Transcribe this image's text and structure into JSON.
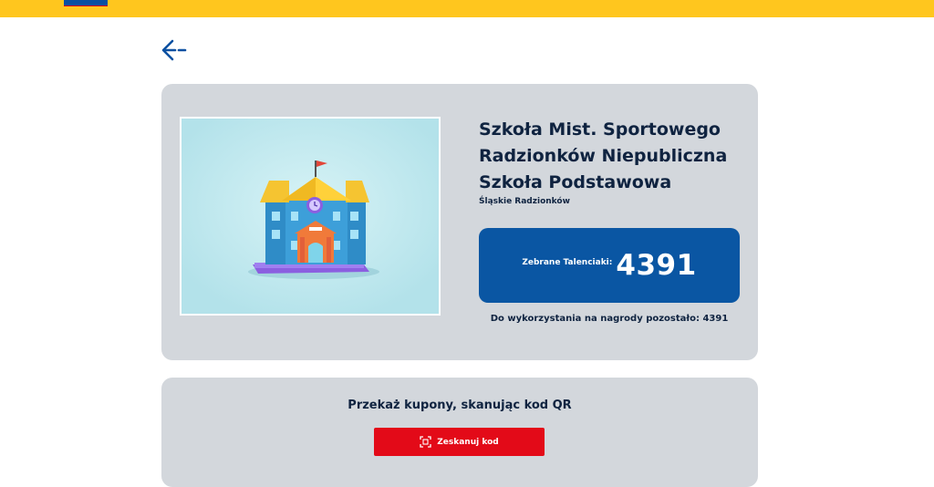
{
  "header": {
    "logo_icon": "lidl-logo"
  },
  "nav": {
    "back_icon": "arrow-left-icon"
  },
  "school": {
    "name": "Szkoła Mist. Sportowego Radzionków Niepubliczna Szkoła Podstawowa",
    "region": "Śląskie Radzionków"
  },
  "talents": {
    "label": "Zebrane Talenciaki:",
    "value": "4391",
    "remaining_text": "Do wykorzystania na nagrody pozostało: 4391"
  },
  "qr_section": {
    "text": "Przekaż kupony, skanując kod QR",
    "button_label": "Zeskanuj kod",
    "button_icon": "qr-scan-icon"
  },
  "colors": {
    "header_bg": "#ffc61e",
    "card_bg": "#d3d7dc",
    "talent_box": "#0a56a3",
    "button_red": "#e30a18",
    "text_dark": "#0f2340"
  }
}
